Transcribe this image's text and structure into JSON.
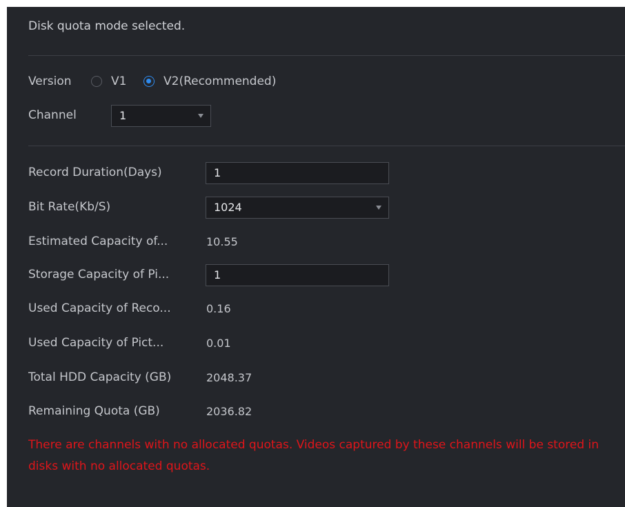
{
  "header": {
    "message": "Disk quota mode selected."
  },
  "version": {
    "label": "Version",
    "options": [
      {
        "label": "V1",
        "checked": false
      },
      {
        "label": "V2(Recommended)",
        "checked": true
      }
    ]
  },
  "channel": {
    "label": "Channel",
    "value": "1"
  },
  "fields": {
    "record_duration": {
      "label": "Record Duration(Days)",
      "value": "1"
    },
    "bit_rate": {
      "label": "Bit Rate(Kb/S)",
      "value": "1024"
    },
    "estimated_capacity": {
      "label": "Estimated Capacity of...",
      "value": "10.55"
    },
    "storage_capacity_pic": {
      "label": "Storage Capacity of Pi...",
      "value": "1"
    },
    "used_capacity_record": {
      "label": "Used Capacity of Reco...",
      "value": "0.16"
    },
    "used_capacity_picture": {
      "label": "Used Capacity of Pict...",
      "value": "0.01"
    },
    "total_hdd": {
      "label": "Total HDD Capacity (GB)",
      "value": "2048.37"
    },
    "remaining_quota": {
      "label": "Remaining Quota (GB)",
      "value": "2036.82"
    }
  },
  "warning": {
    "text": "There are channels with no allocated quotas. Videos captured by these channels will be stored in disks with no allocated quotas."
  },
  "colors": {
    "background": "#24262b",
    "accent": "#2f8cf0",
    "warning": "#e0151a"
  },
  "icons": {
    "dropdown": "chevron-down-icon"
  }
}
